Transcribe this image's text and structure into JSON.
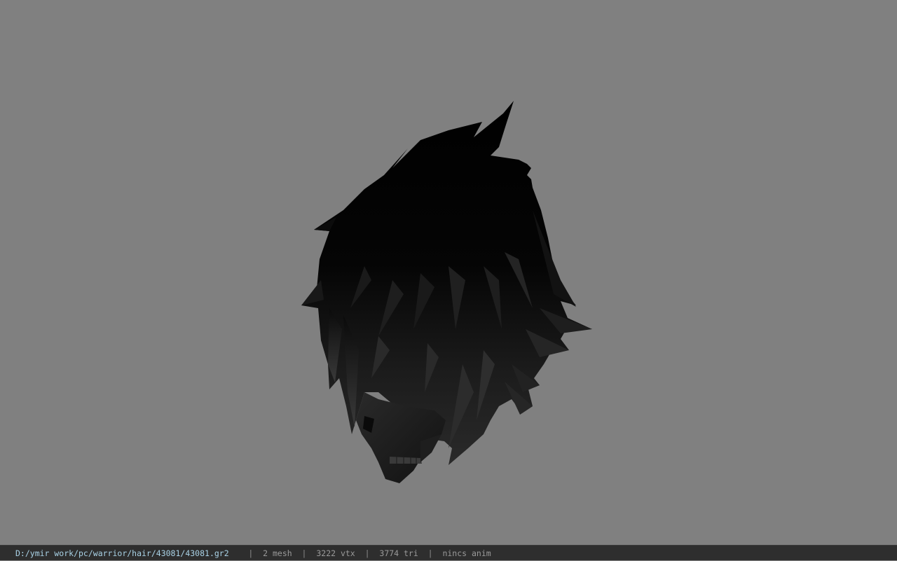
{
  "viewer": {
    "background_color": "#808080",
    "model_color": "#000000",
    "model_icon": "hair-mesh"
  },
  "status": {
    "file_path": "D:/ymir work/pc/warrior/hair/43081/43081.gr2",
    "separator": "|",
    "mesh": "2 mesh",
    "vertices": "3222 vtx",
    "triangles": "3774 tri",
    "animation": "nincs anim",
    "bar_color": "#2e2e2e",
    "path_color": "#a9d2e6"
  }
}
